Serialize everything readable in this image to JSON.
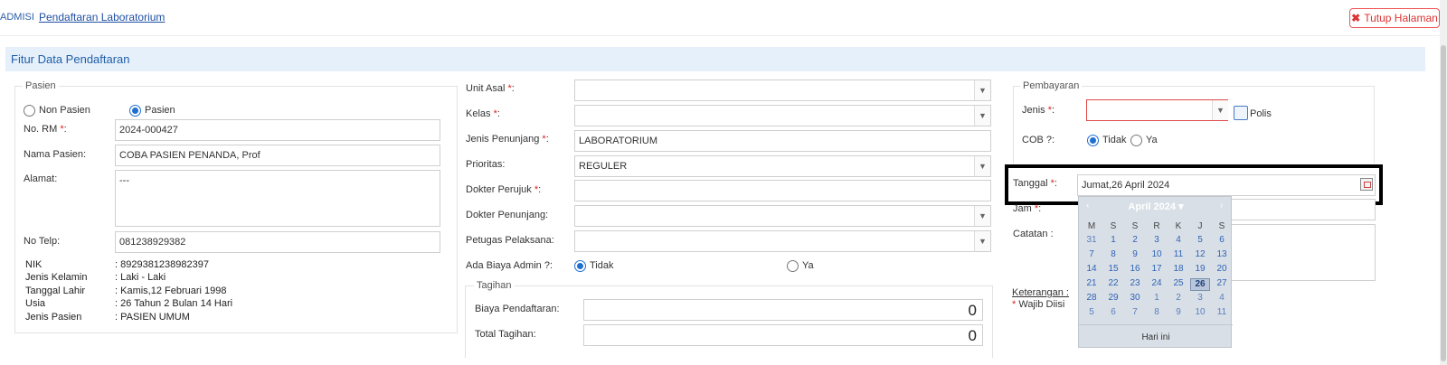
{
  "breadcrumb": {
    "first": "ADMISI",
    "current": "Pendaftaran Laboratorium"
  },
  "close_button": {
    "label": "Tutup Halaman",
    "icon": "x-icon"
  },
  "panel_title": "Fitur Data Pendaftaran",
  "pasien": {
    "legend": "Pasien",
    "radio_non_pasien": "Non Pasien",
    "radio_pasien": "Pasien",
    "selected": "Pasien",
    "no_rm_label": "No. RM ",
    "no_rm_value": "2024-000427",
    "nama_label": "Nama Pasien:",
    "nama_value": "COBA PASIEN PENANDA, Prof",
    "alamat_label": "Alamat:",
    "alamat_value": "---",
    "telp_label": "No Telp:",
    "telp_value": "081238929382",
    "info": [
      {
        "key": "NIK",
        "value": ": 8929381238982397"
      },
      {
        "key": "Jenis Kelamin",
        "value": ": Laki - Laki"
      },
      {
        "key": "Tanggal Lahir",
        "value": ": Kamis,12 Februari 1998"
      },
      {
        "key": "Usia",
        "value": ": 26 Tahun 2 Bulan 14 Hari"
      },
      {
        "key": "Jenis Pasien",
        "value": ": PASIEN UMUM"
      }
    ]
  },
  "middle": {
    "unit_asal_label": "Unit Asal ",
    "unit_asal_value": "",
    "kelas_label": "Kelas ",
    "kelas_value": "",
    "jenis_penunjang_label": "Jenis Penunjang ",
    "jenis_penunjang_value": "LABORATORIUM",
    "prioritas_label": "Prioritas:",
    "prioritas_value": "REGULER",
    "dokter_perujuk_label": "Dokter Perujuk ",
    "dokter_perujuk_value": "",
    "dokter_penunjang_label": "Dokter Penunjang:",
    "dokter_penunjang_value": "",
    "petugas_label": "Petugas Pelaksana:",
    "petugas_value": "",
    "biaya_admin_label": "Ada Biaya Admin ?:",
    "biaya_admin_tidak": "Tidak",
    "biaya_admin_ya": "Ya",
    "tagihan": {
      "legend": "Tagihan",
      "biaya_label": "Biaya Pendaftaran:",
      "biaya_value": "0",
      "total_label": "Total Tagihan:",
      "total_value": "0"
    }
  },
  "pembayaran": {
    "legend": "Pembayaran",
    "jenis_label": "Jenis ",
    "jenis_value": "",
    "polis_label": "Polis",
    "cob_label": "COB ?:",
    "cob_tidak": "Tidak",
    "cob_ya": "Ya",
    "tanggal_label": "Tanggal ",
    "tanggal_value": "Jumat,26 April 2024",
    "jam_label": "Jam ",
    "catatan_label": "Catatan :",
    "keterangan_label": "Keterangan :",
    "wajib_label": "Wajib Diisi",
    "asterisk": "*",
    "colon": ":"
  },
  "calendar": {
    "month_label": "April 2024",
    "prev": "‹",
    "next": "›",
    "dropdown": "▾",
    "weekdays": [
      "M",
      "S",
      "S",
      "R",
      "K",
      "J",
      "S"
    ],
    "weeks": [
      [
        "31",
        "1",
        "2",
        "3",
        "4",
        "5",
        "6"
      ],
      [
        "7",
        "8",
        "9",
        "10",
        "11",
        "12",
        "13"
      ],
      [
        "14",
        "15",
        "16",
        "17",
        "18",
        "19",
        "20"
      ],
      [
        "21",
        "22",
        "23",
        "24",
        "25",
        "26",
        "27"
      ],
      [
        "28",
        "29",
        "30",
        "1",
        "2",
        "3",
        "4"
      ],
      [
        "5",
        "6",
        "7",
        "8",
        "9",
        "10",
        "11"
      ]
    ],
    "selected_day": "26",
    "today_label": "Hari ini"
  },
  "colors": {
    "accent": "#1f5fa8",
    "required": "#dd2222",
    "panel_bg": "#e6f0fb"
  }
}
